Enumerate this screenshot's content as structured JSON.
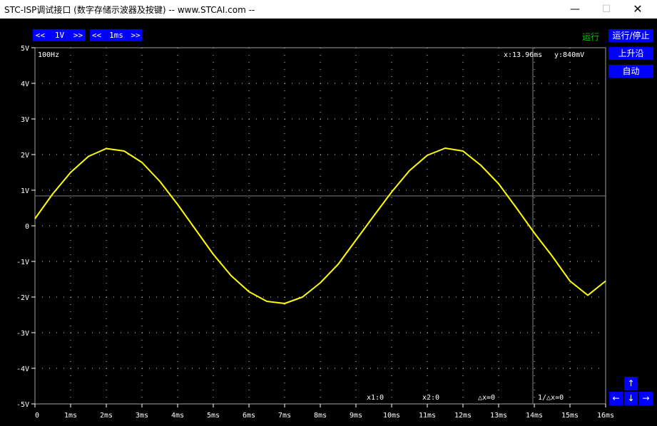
{
  "window": {
    "title": "STC-ISP调试接口 (数字存储示波器及按键) -- www.STCAI.com --",
    "min_glyph": "—",
    "max_glyph": "☐",
    "close_glyph": "✕"
  },
  "toolbar": {
    "volt_left": "<<",
    "volt_value": "1V",
    "volt_right": ">>",
    "time_left": "<<",
    "time_value": "1ms",
    "time_right": ">>"
  },
  "status": {
    "run_state": "运行",
    "run_state_color": "#00c000"
  },
  "sidebar": {
    "run_stop_label": "运行/停止",
    "edge_label": "上升沿",
    "auto_label": "自动"
  },
  "arrows": {
    "up": "↑",
    "down": "↓",
    "left": "←",
    "right": "→"
  },
  "scope": {
    "frequency": "100Hz",
    "cursor_readout_x": "x:13.96ms",
    "cursor_readout_y": "y:840mV",
    "y_ticks": [
      "5V",
      "4V",
      "3V",
      "2V",
      "1V",
      "0",
      "-1V",
      "-2V",
      "-3V",
      "-4V",
      "-5V"
    ],
    "x_ticks": [
      "0",
      "1ms",
      "2ms",
      "3ms",
      "4ms",
      "5ms",
      "6ms",
      "7ms",
      "8ms",
      "9ms",
      "10ms",
      "11ms",
      "12ms",
      "13ms",
      "14ms",
      "15ms",
      "16ms"
    ],
    "measure": {
      "x1": "x1:0",
      "x2": "x2:0",
      "dx": "△x=0",
      "inv_dx": "1/△x=0"
    },
    "trace_color": "#ffff00",
    "grid_color": "#808080"
  },
  "chart_data": {
    "type": "line",
    "title": "",
    "xlabel": "",
    "ylabel": "",
    "xlim": [
      0,
      16
    ],
    "ylim": [
      -5,
      5
    ],
    "grid": true,
    "cursor": {
      "x": 13.96,
      "y": 0.84
    },
    "series": [
      {
        "x": [
          0,
          0.5,
          1,
          1.5,
          2,
          2.5,
          3,
          3.5,
          4,
          4.5,
          5,
          5.5,
          6,
          6.5,
          7,
          7.5,
          8,
          8.5,
          9,
          9.5,
          10,
          10.5,
          11,
          11.5,
          12,
          12.5,
          13,
          13.5,
          14,
          14.5,
          15,
          15.5,
          16
        ],
        "values": [
          0.2,
          0.9,
          1.5,
          1.95,
          2.17,
          2.1,
          1.78,
          1.25,
          0.6,
          -0.1,
          -0.8,
          -1.4,
          -1.85,
          -2.12,
          -2.18,
          -2.0,
          -1.6,
          -1.08,
          -0.4,
          0.28,
          0.95,
          1.55,
          1.98,
          2.18,
          2.1,
          1.7,
          1.18,
          0.5,
          -0.2,
          -0.85,
          -1.55,
          -1.95,
          -1.55
        ]
      }
    ]
  }
}
